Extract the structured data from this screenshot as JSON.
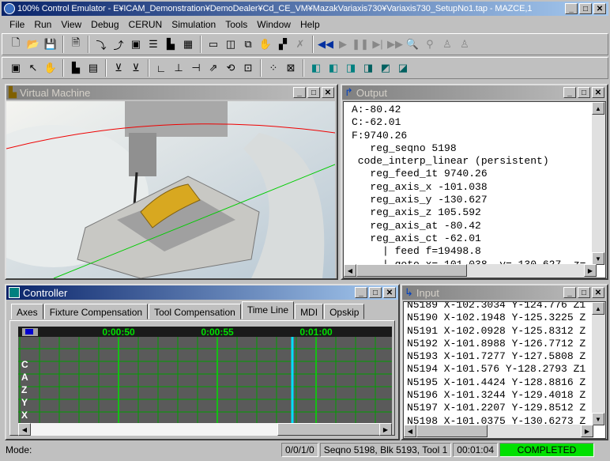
{
  "app": {
    "title": "100% Control Emulator - E¥ICAM_Demonstration¥DemoDealer¥Cd_CE_VM¥MazakVariaxis730¥Variaxis730_SetupNo1.tap - MAZCE,1"
  },
  "menu": [
    "File",
    "Run",
    "View",
    "Debug",
    "CERUN",
    "Simulation",
    "Tools",
    "Window",
    "Help"
  ],
  "toolbar1": [
    "new-file",
    "open-folder",
    "save",
    "print-preview",
    "step-in",
    "step-out",
    "machine-window",
    "output-list",
    "machine-tool",
    "controller-panel",
    "window-a",
    "window-b",
    "window-c",
    "hand",
    "blocks",
    "disabled-x",
    "rewind",
    "play",
    "pause",
    "step",
    "fast-forward",
    "inspect",
    "binoculars",
    "user-a",
    "user-b"
  ],
  "toolbar2": [
    "camera",
    "pointer",
    "hand-alt",
    "machine-tool",
    "layer",
    "tool-red",
    "tool-green",
    "view-iso",
    "view-front",
    "view-side",
    "axes",
    "rotate",
    "zoom-fit",
    "grid",
    "center",
    "cube-1",
    "cube-2",
    "cube-3",
    "cube-4",
    "cube-5",
    "cube-6"
  ],
  "vm": {
    "title": "Virtual Machine"
  },
  "output": {
    "title": "Output",
    "lines": [
      "A:-80.42",
      "C:-62.01",
      "F:9740.26",
      "   reg_seqno 5198",
      " code_interp_linear (persistent)",
      "   reg_feed_1t 9740.26",
      "   reg_axis_x -101.038",
      "   reg_axis_y -130.627",
      "   reg_axis_z 105.592",
      "   reg_axis_at -80.42",
      "   reg_axis_ct -62.01",
      "     | feed f=19498.8",
      "     | goto x=-101.038, y=-130.627, z="
    ]
  },
  "controller": {
    "title": "Controller",
    "tabs": [
      "Axes",
      "Fixture Compensation",
      "Tool Compensation",
      "Time Line",
      "MDI",
      "Opskip"
    ],
    "active_tab": "Time Line",
    "timeline": {
      "times": [
        "0:00:50",
        "0:00:55",
        "0:01:00"
      ],
      "axes": [
        "C",
        "A",
        "Z",
        "Y",
        "X"
      ],
      "grid_color": "#00a000",
      "cursor_color": "#00e0ff"
    }
  },
  "input": {
    "title": "Input",
    "lines": [
      "N5189 X-102.3034 Y-124.776 Z1",
      "N5190 X-102.1948 Y-125.3225 Z",
      "N5191 X-102.0928 Y-125.8312 Z",
      "N5192 X-101.8988 Y-126.7712 Z",
      "N5193 X-101.7277 Y-127.5808 Z",
      "N5194 X-101.576 Y-128.2793 Z1",
      "N5195 X-101.4424 Y-128.8816 Z",
      "N5196 X-101.3244 Y-129.4018 Z",
      "N5197 X-101.2207 Y-129.8512 Z",
      "N5198 X-101.0375 Y-130.6273 Z"
    ]
  },
  "status": {
    "mode": "Mode:",
    "counter": "0/0/1/0",
    "seq": "Seqno 5198, Blk 5193, Tool 1",
    "time": "00:01:04",
    "state": "COMPLETED",
    "state_color": "#00e000"
  }
}
